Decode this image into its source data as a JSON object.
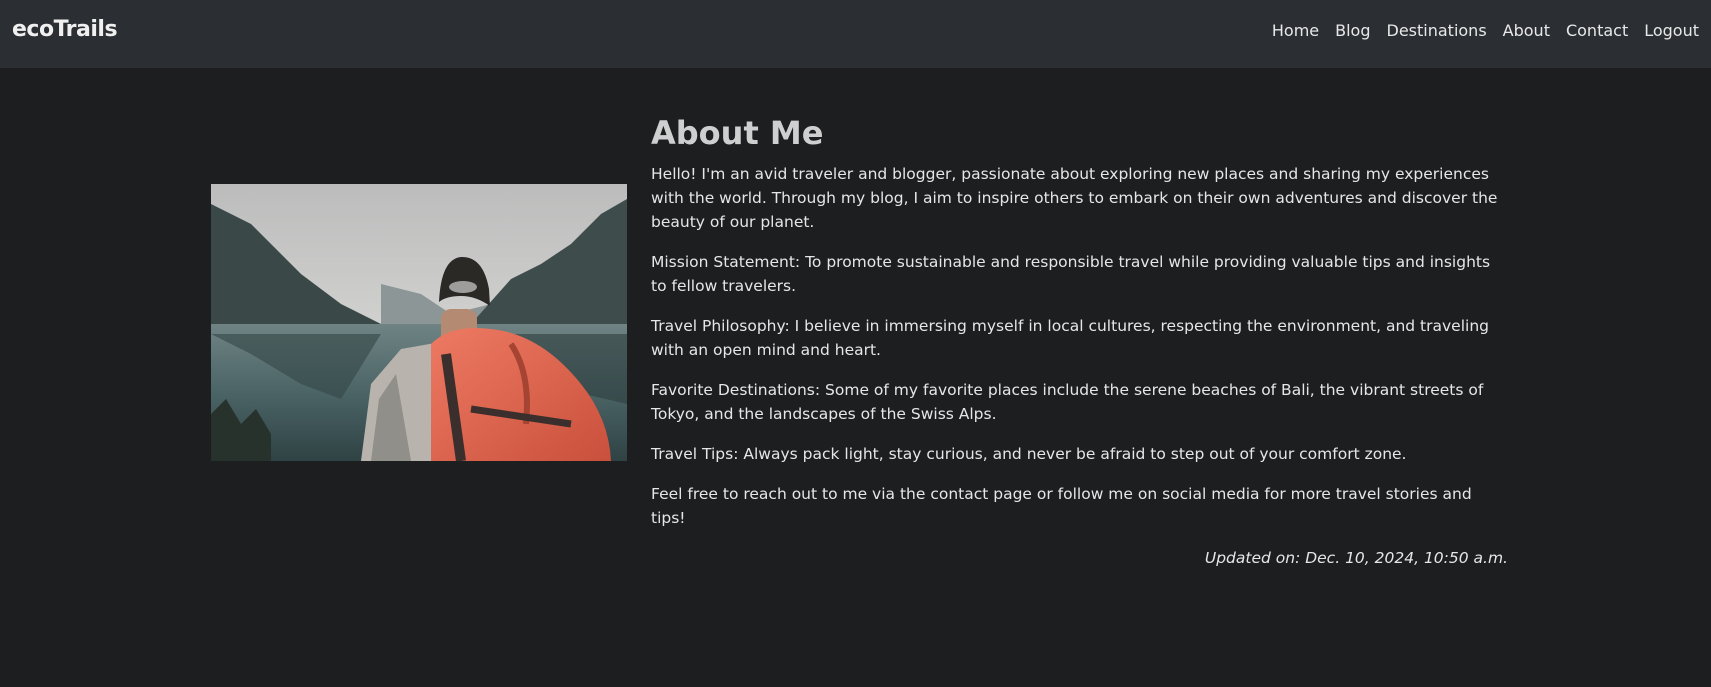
{
  "navbar": {
    "brand": "ecoTrails",
    "links": [
      "Home",
      "Blog",
      "Destinations",
      "About",
      "Contact",
      "Logout"
    ]
  },
  "about": {
    "title": "About Me",
    "paragraphs": [
      "Hello! I'm an avid traveler and blogger, passionate about exploring new places and sharing my experiences with the world. Through my blog, I aim to inspire others to embark on their own adventures and discover the beauty of our planet.",
      "Mission Statement: To promote sustainable and responsible travel while providing valuable tips and insights to fellow travelers.",
      "Travel Philosophy: I believe in immersing myself in local cultures, respecting the environment, and traveling with an open mind and heart.",
      "Favorite Destinations: Some of my favorite places include the serene beaches of Bali, the vibrant streets of Tokyo, and the landscapes of the Swiss Alps.",
      "Travel Tips: Always pack light, stay curious, and never be afraid to step out of your comfort zone.",
      "Feel free to reach out to me via the contact page or follow me on social media for more travel stories and tips!"
    ],
    "updated": "Updated on: Dec. 10, 2024, 10:50 a.m."
  },
  "colors": {
    "page_bg": "#1c1e20",
    "navbar_bg": "#2b2f33",
    "backpack": "#e06a55",
    "lake": "#3f5a5c"
  }
}
